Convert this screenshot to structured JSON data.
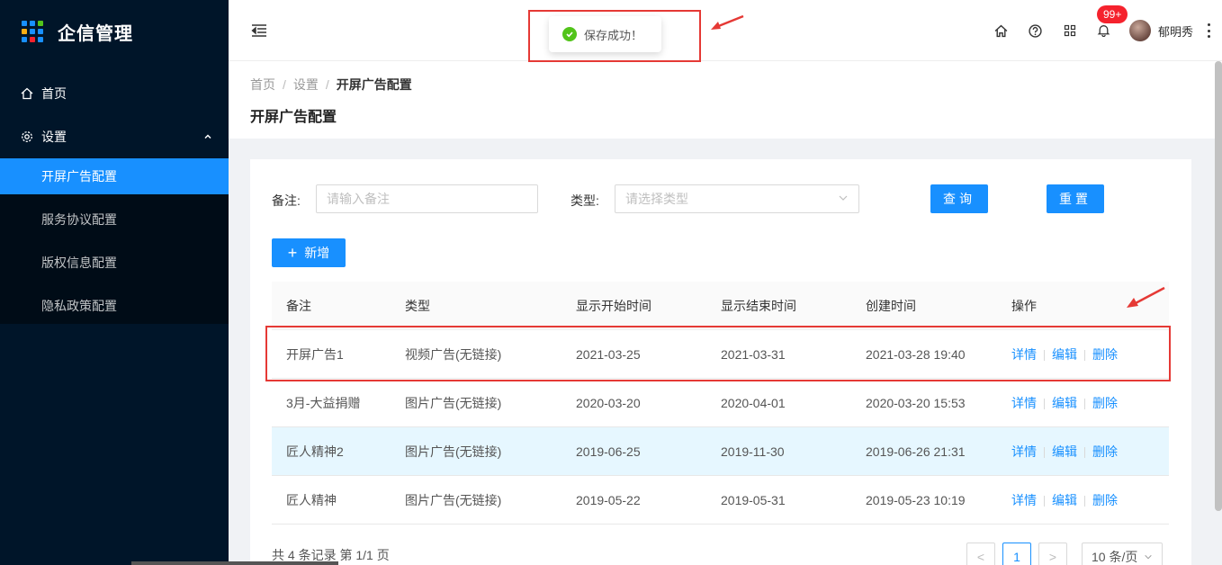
{
  "app": {
    "title": "企信管理"
  },
  "sidebar": {
    "home": "首页",
    "settings": "设置",
    "subitems": [
      {
        "label": "开屏广告配置",
        "active": true
      },
      {
        "label": "服务协议配置",
        "active": false
      },
      {
        "label": "版权信息配置",
        "active": false
      },
      {
        "label": "隐私政策配置",
        "active": false
      }
    ]
  },
  "header": {
    "badge": "99+",
    "username": "郁明秀"
  },
  "toast": {
    "message": "保存成功！"
  },
  "breadcrumb": {
    "items": [
      "首页",
      "设置",
      "开屏广告配置"
    ]
  },
  "page": {
    "title": "开屏广告配置"
  },
  "filters": {
    "remark_label": "备注:",
    "remark_placeholder": "请输入备注",
    "type_label": "类型:",
    "type_placeholder": "请选择类型",
    "query_button": "查询",
    "reset_button": "重置",
    "add_button": "新增"
  },
  "table": {
    "columns": [
      "备注",
      "类型",
      "显示开始时间",
      "显示结束时间",
      "创建时间",
      "操作"
    ],
    "rows": [
      {
        "remark": "开屏广告1",
        "type": "视频广告(无链接)",
        "start": "2021-03-25",
        "end": "2021-03-31",
        "created": "2021-03-28 19:40"
      },
      {
        "remark": "3月-大益捐赠",
        "type": "图片广告(无链接)",
        "start": "2020-03-20",
        "end": "2020-04-01",
        "created": "2020-03-20 15:53"
      },
      {
        "remark": "匠人精神2",
        "type": "图片广告(无链接)",
        "start": "2019-06-25",
        "end": "2019-11-30",
        "created": "2019-06-26 21:31"
      },
      {
        "remark": "匠人精神",
        "type": "图片广告(无链接)",
        "start": "2019-05-22",
        "end": "2019-05-31",
        "created": "2019-05-23 10:19"
      }
    ],
    "actions": {
      "detail": "详情",
      "edit": "编辑",
      "delete": "删除"
    }
  },
  "pagination": {
    "summary": "共 4 条记录 第 1/1 页",
    "prev": "<",
    "current": "1",
    "next": ">",
    "page_size": "10 条/页"
  },
  "colors": {
    "sidebar_bg": "#001529",
    "primary": "#1890ff",
    "highlight_row": "#e6f7ff",
    "annotation_red": "#e53935",
    "success": "#52c41a"
  }
}
